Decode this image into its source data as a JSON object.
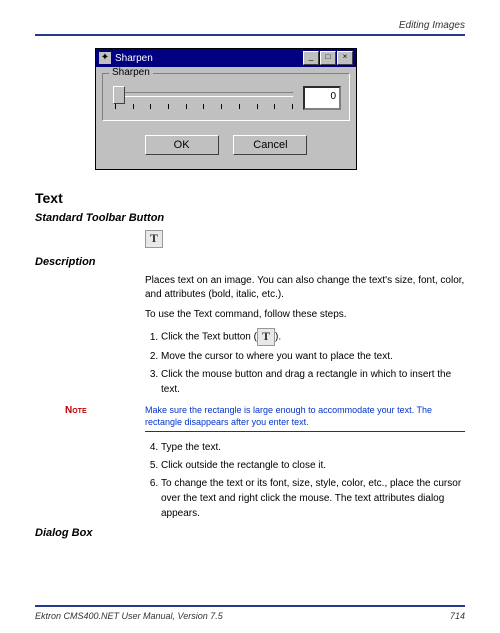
{
  "header": {
    "section": "Editing Images"
  },
  "dialog": {
    "title": "Sharpen",
    "group_label": "Sharpen",
    "value": "0",
    "ok": "OK",
    "cancel": "Cancel"
  },
  "section": {
    "title": "Text",
    "subhead_toolbar": "Standard Toolbar Button",
    "subhead_desc": "Description",
    "subhead_dialogbox": "Dialog Box",
    "toolbar_glyph": "T",
    "desc_p1": "Places text on an image. You can also change the text's size, font, color, and attributes (bold, italic, etc.).",
    "desc_p2": "To use the Text command, follow these steps.",
    "steps_a": [
      "Click the Text button (",
      "Move the cursor to where you want to place the text.",
      "Click the mouse button and drag a rectangle in which to insert the text."
    ],
    "step1_suffix": ").",
    "note_label": "Note",
    "note_text": "Make sure the rectangle is large enough to accommodate your text. The rectangle disappears after you enter text.",
    "steps_b": [
      "Type the text.",
      "Click outside the rectangle to close it.",
      "To change the text or its font, size, style, color, etc., place the cursor over the text and right click the mouse. The text attributes dialog appears."
    ]
  },
  "footer": {
    "product": "Ektron CMS400.NET User Manual, Version 7.5",
    "page": "714"
  }
}
